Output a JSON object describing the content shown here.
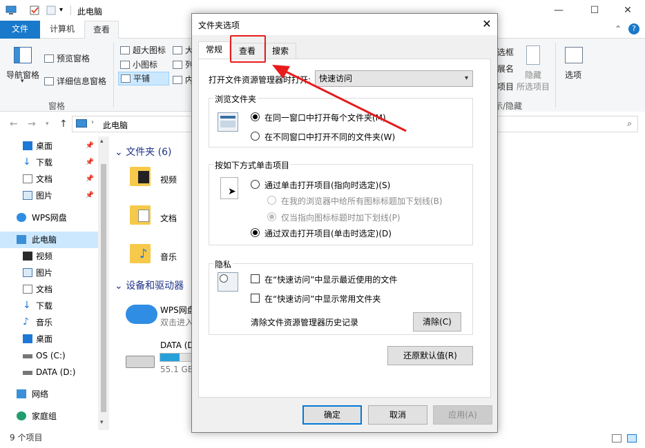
{
  "window": {
    "title": "此电脑",
    "min_glyph": "—",
    "max_glyph": "☐",
    "close_glyph": "✕"
  },
  "ribbon": {
    "tabs": [
      "文件",
      "计算机",
      "查看"
    ],
    "nav_pane": "导航窗格",
    "preview_pane": "预览窗格",
    "details_pane": "详细信息窗格",
    "group_panes": "窗格",
    "layout": [
      "超大图标",
      "小图标",
      "平铺",
      "大",
      "列",
      "内"
    ],
    "right_partial": [
      "选框",
      "展名",
      "项目"
    ],
    "hide_selected": "隐藏",
    "hide_selected2": "所选项目",
    "options": "选项",
    "group_showhide": "示/隐藏"
  },
  "address": {
    "path": "此电脑",
    "back": "←",
    "forward": "→",
    "up": "↑"
  },
  "nav": {
    "items": [
      {
        "label": "桌面",
        "pinned": true
      },
      {
        "label": "下载",
        "pinned": true
      },
      {
        "label": "文档",
        "pinned": true
      },
      {
        "label": "图片",
        "pinned": true
      },
      {
        "label": "WPS网盘"
      },
      {
        "label": "此电脑"
      },
      {
        "label": "视频"
      },
      {
        "label": "图片"
      },
      {
        "label": "文档"
      },
      {
        "label": "下载"
      },
      {
        "label": "音乐"
      },
      {
        "label": "桌面"
      },
      {
        "label": "OS (C:)"
      },
      {
        "label": "DATA (D:)"
      },
      {
        "label": "网络"
      },
      {
        "label": "家庭组"
      }
    ]
  },
  "content": {
    "folders_header": "文件夹 (6)",
    "folders": [
      "视频",
      "文档",
      "音乐"
    ],
    "devices_header": "设备和驱动器",
    "wps_name": "WPS网盘",
    "wps_sub": "双击进入",
    "data_name": "DATA (D",
    "data_free": "55.1 GB",
    "data_used_fraction": 0.6
  },
  "status": {
    "count": "9 个项目"
  },
  "dialog": {
    "title": "文件夹选项",
    "close_glyph": "✕",
    "tabs": [
      "常规",
      "查看",
      "搜索"
    ],
    "open_label": "打开文件资源管理器时打开:",
    "open_value": "快速访问",
    "browse_group": "浏览文件夹",
    "browse_same": "在同一窗口中打开每个文件夹(M)",
    "browse_new": "在不同窗口中打开不同的文件夹(W)",
    "click_group": "按如下方式单击项目",
    "click_single": "通过单击打开项目(指向时选定)(S)",
    "underline_all": "在我的浏览器中给所有图标标题加下划线(B)",
    "underline_point": "仅当指向图标标题时加下划线(P)",
    "click_double": "通过双击打开项目(单击时选定)(D)",
    "privacy_group": "隐私",
    "privacy_recent": "在“快速访问”中显示最近使用的文件",
    "privacy_frequent": "在“快速访问”中显示常用文件夹",
    "clear_history": "清除文件资源管理器历史记录",
    "clear_btn": "清除(C)",
    "restore_btn": "还原默认值(R)",
    "ok": "确定",
    "cancel": "取消",
    "apply": "应用(A)"
  },
  "colors": {
    "accent": "#1979ca",
    "highlight": "#e81b1b",
    "selection": "#cce8ff",
    "drive_bar": "#26a0da"
  }
}
